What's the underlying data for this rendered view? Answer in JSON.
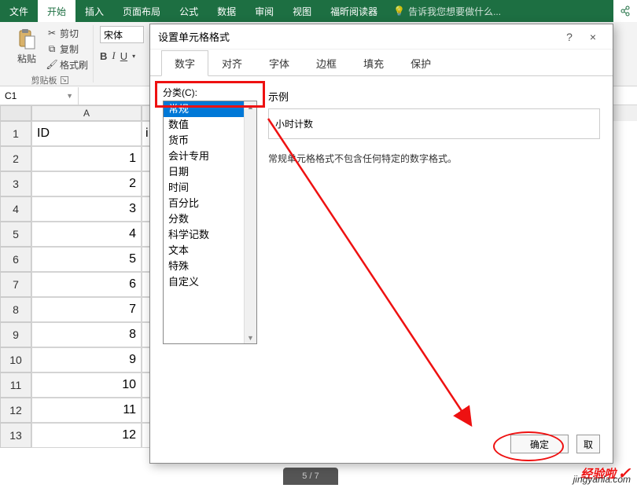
{
  "ribbon": {
    "tabs": [
      "文件",
      "开始",
      "插入",
      "页面布局",
      "公式",
      "数据",
      "审阅",
      "视图",
      "福昕阅读器"
    ],
    "active_tab": "开始",
    "tellme": "告诉我您想要做什么...",
    "paste_label": "粘贴",
    "cut_label": "剪切",
    "copy_label": "复制",
    "format_painter_label": "格式刷",
    "clipboard_group_label": "剪贴板",
    "font_name": "宋体",
    "bold": "B",
    "italic": "I",
    "underline": "U"
  },
  "namebox": {
    "value": "C1"
  },
  "sheet": {
    "colA_label": "A",
    "header_A": "ID",
    "header_B": "i",
    "rows": [
      {
        "n": "1",
        "a": "ID"
      },
      {
        "n": "2",
        "a": "1"
      },
      {
        "n": "3",
        "a": "2"
      },
      {
        "n": "4",
        "a": "3"
      },
      {
        "n": "5",
        "a": "4"
      },
      {
        "n": "6",
        "a": "5"
      },
      {
        "n": "7",
        "a": "6"
      },
      {
        "n": "8",
        "a": "7"
      },
      {
        "n": "9",
        "a": "8"
      },
      {
        "n": "10",
        "a": "9"
      },
      {
        "n": "11",
        "a": "10"
      },
      {
        "n": "12",
        "a": "11"
      },
      {
        "n": "13",
        "a": "12"
      }
    ]
  },
  "dialog": {
    "title": "设置单元格格式",
    "help": "?",
    "close": "×",
    "tabs": [
      "数字",
      "对齐",
      "字体",
      "边框",
      "填充",
      "保护"
    ],
    "active_tab": "数字",
    "category_label": "分类(C):",
    "categories": [
      "常规",
      "数值",
      "货币",
      "会计专用",
      "日期",
      "时间",
      "百分比",
      "分数",
      "科学记数",
      "文本",
      "特殊",
      "自定义"
    ],
    "selected_category": "常规",
    "sample_label": "示例",
    "sample_value": "小时计数",
    "description": "常规单元格格式不包含任何特定的数字格式。",
    "ok": "确定",
    "cancel": "取"
  },
  "watermark": "jingyanla.com",
  "watermark_prefix": "经验啦",
  "page_indicator": "5 / 7"
}
